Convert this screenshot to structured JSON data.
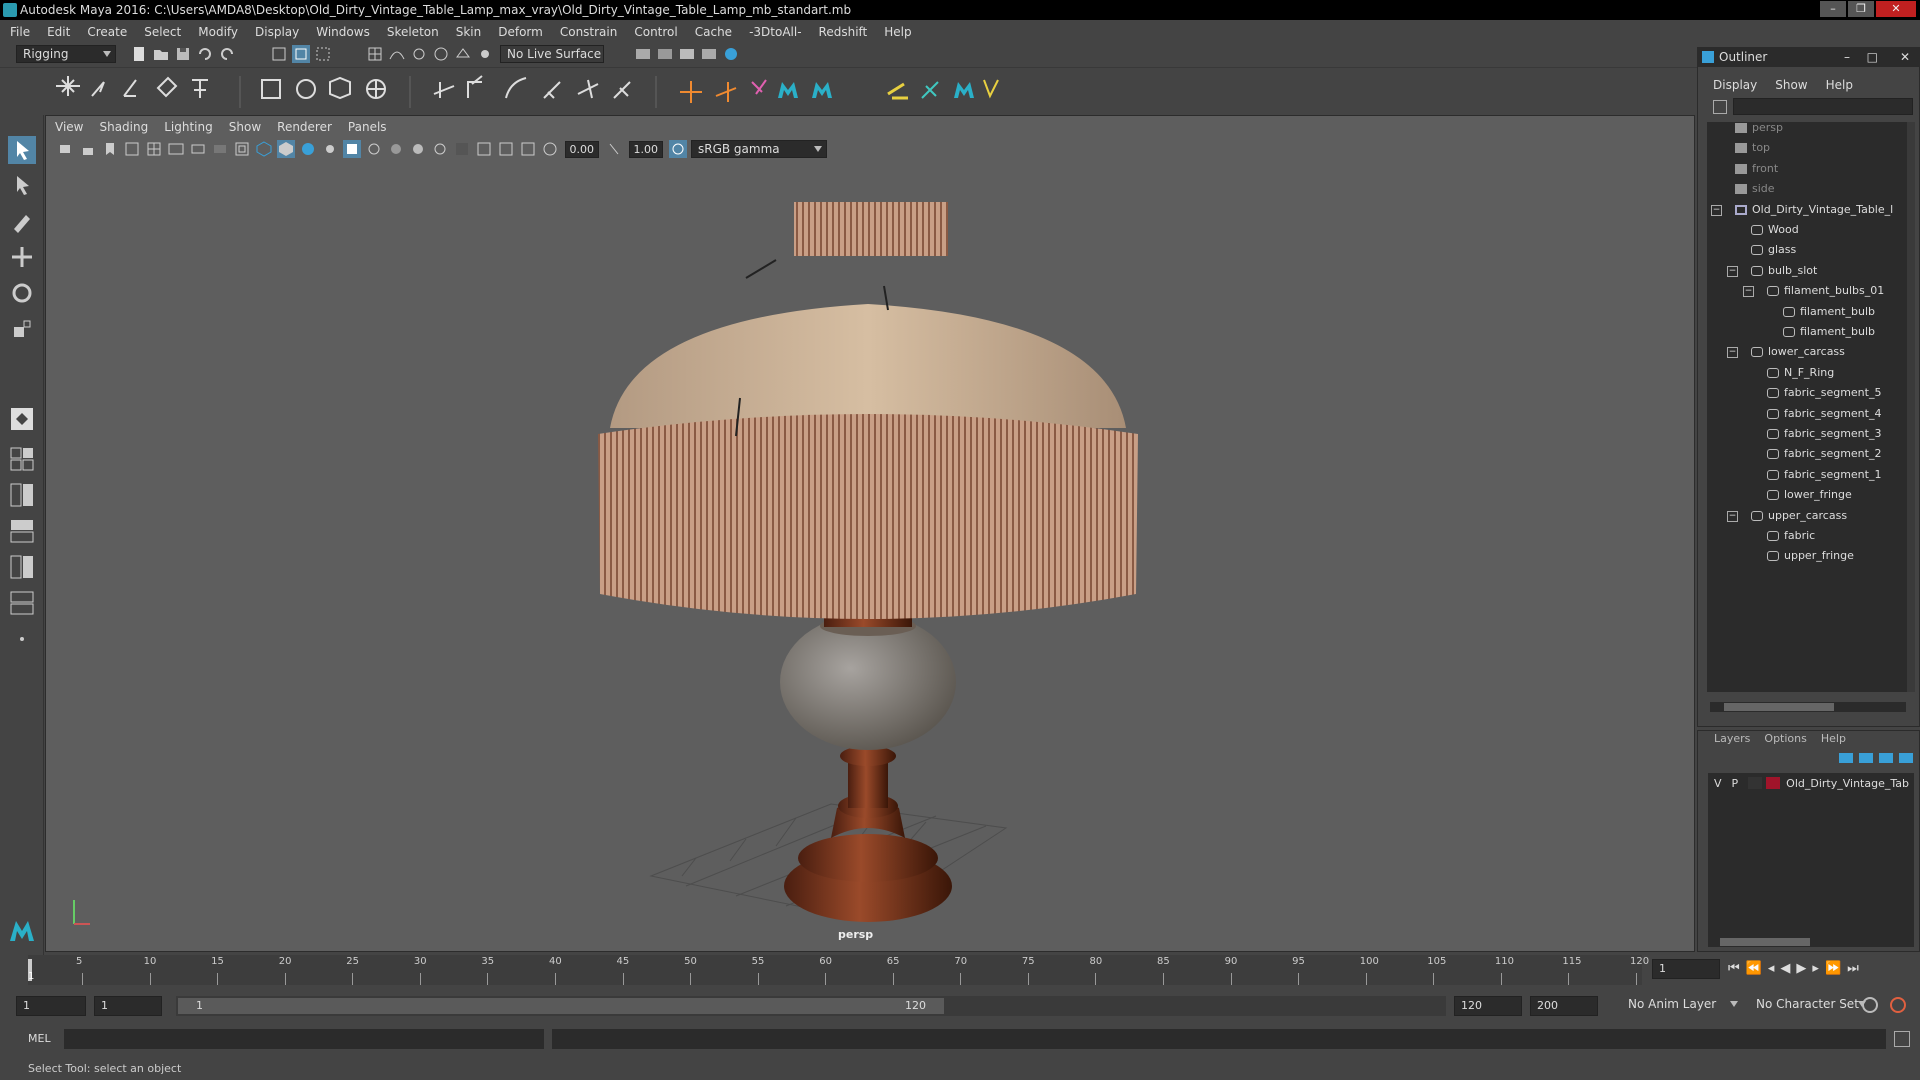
{
  "window": {
    "title": "Autodesk Maya 2016: C:\\Users\\AMDA8\\Desktop\\Old_Dirty_Vintage_Table_Lamp_max_vray\\Old_Dirty_Vintage_Table_Lamp_mb_standart.mb",
    "min": "–",
    "max": "❐",
    "close": "✕"
  },
  "menubar": [
    "File",
    "Edit",
    "Create",
    "Select",
    "Modify",
    "Display",
    "Windows",
    "Skeleton",
    "Skin",
    "Deform",
    "Constrain",
    "Control",
    "Cache",
    "-3DtoAll-",
    "Redshift",
    "Help"
  ],
  "toolbar": {
    "mode": "Rigging",
    "live_surface": "No Live Surface"
  },
  "viewport": {
    "menu": [
      "View",
      "Shading",
      "Lighting",
      "Show",
      "Renderer",
      "Panels"
    ],
    "exposure": "0.00",
    "gamma": "1.00",
    "colorspace": "sRGB gamma",
    "camera_label": "persp"
  },
  "outliner": {
    "title": "Outliner",
    "menu": [
      "Display",
      "Show",
      "Help"
    ],
    "items": [
      {
        "label": "persp",
        "level": 1,
        "type": "camera",
        "dim": true
      },
      {
        "label": "top",
        "level": 1,
        "type": "camera",
        "dim": true
      },
      {
        "label": "front",
        "level": 1,
        "type": "camera",
        "dim": true
      },
      {
        "label": "side",
        "level": 1,
        "type": "camera",
        "dim": true
      },
      {
        "label": "Old_Dirty_Vintage_Table_l",
        "level": 1,
        "type": "group",
        "expand": true
      },
      {
        "label": "Wood",
        "level": 2,
        "type": "mesh"
      },
      {
        "label": "glass",
        "level": 2,
        "type": "mesh"
      },
      {
        "label": "bulb_slot",
        "level": 2,
        "type": "mesh",
        "expand": true
      },
      {
        "label": "filament_bulbs_01",
        "level": 3,
        "type": "mesh",
        "expand": true
      },
      {
        "label": "filament_bulb",
        "level": 4,
        "type": "mesh"
      },
      {
        "label": "filament_bulb",
        "level": 4,
        "type": "mesh"
      },
      {
        "label": "lower_carcass",
        "level": 2,
        "type": "mesh",
        "expand": true
      },
      {
        "label": "N_F_Ring",
        "level": 3,
        "type": "mesh"
      },
      {
        "label": "fabric_segment_5",
        "level": 3,
        "type": "mesh"
      },
      {
        "label": "fabric_segment_4",
        "level": 3,
        "type": "mesh"
      },
      {
        "label": "fabric_segment_3",
        "level": 3,
        "type": "mesh"
      },
      {
        "label": "fabric_segment_2",
        "level": 3,
        "type": "mesh"
      },
      {
        "label": "fabric_segment_1",
        "level": 3,
        "type": "mesh"
      },
      {
        "label": "lower_fringe",
        "level": 3,
        "type": "mesh"
      },
      {
        "label": "upper_carcass",
        "level": 2,
        "type": "mesh",
        "expand": true
      },
      {
        "label": "fabric",
        "level": 3,
        "type": "mesh"
      },
      {
        "label": "upper_fringe",
        "level": 3,
        "type": "mesh"
      }
    ]
  },
  "layers": {
    "menu": [
      "Layers",
      "Options",
      "Help"
    ],
    "row": {
      "v": "V",
      "p": "P",
      "name": "Old_Dirty_Vintage_Tab",
      "color": "#a0142a"
    }
  },
  "timeline": {
    "ticks": [
      "5",
      "10",
      "15",
      "20",
      "25",
      "30",
      "35",
      "40",
      "45",
      "50",
      "55",
      "60",
      "65",
      "70",
      "75",
      "80",
      "85",
      "90",
      "95",
      "100",
      "105",
      "110",
      "115",
      "120"
    ],
    "start_marker": "1",
    "current_frame": "1"
  },
  "range": {
    "start": "1",
    "playback_start": "1",
    "slider_start": "1",
    "slider_end": "120",
    "playback_end": "120",
    "end": "200",
    "anim_layer": "No Anim Layer",
    "char_set": "No Character Set"
  },
  "mel": {
    "label": "MEL"
  },
  "status": "Select Tool: select an object"
}
